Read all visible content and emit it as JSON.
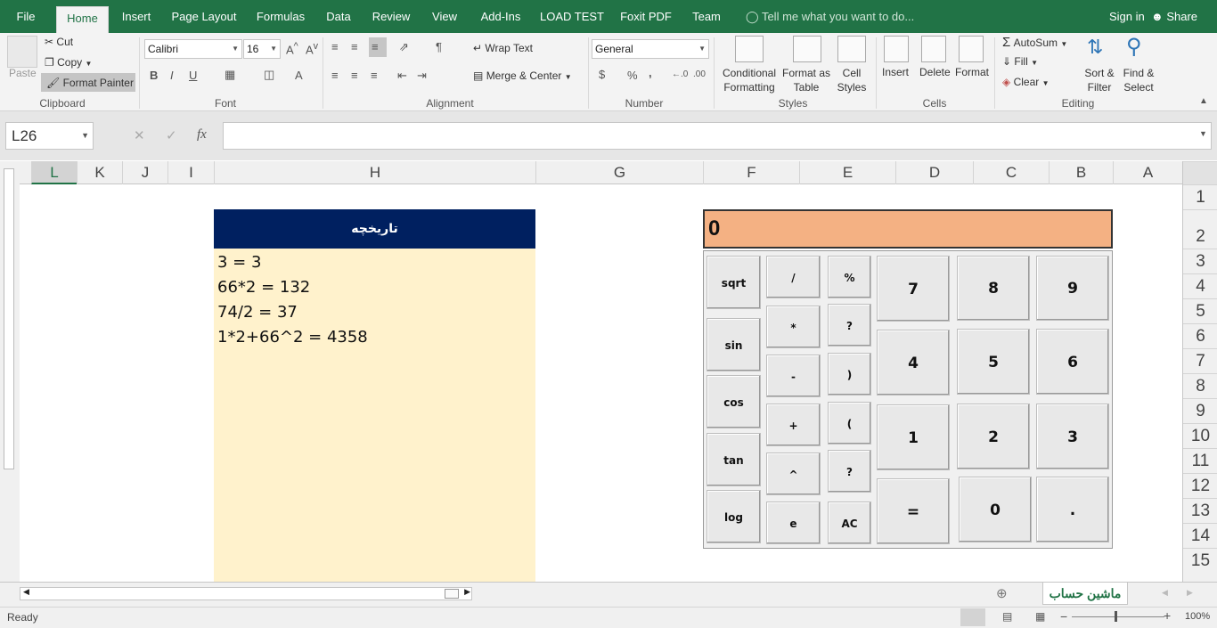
{
  "tabs": {
    "file": "File",
    "home": "Home",
    "insert": "Insert",
    "page_layout": "Page Layout",
    "formulas": "Formulas",
    "data": "Data",
    "review": "Review",
    "view": "View",
    "addins": "Add-Ins",
    "load_test": "LOAD TEST",
    "foxit": "Foxit PDF",
    "team": "Team",
    "tell_me": "Tell me what you want to do...",
    "sign_in": "Sign in",
    "share": "Share"
  },
  "clipboard": {
    "paste": "Paste",
    "cut": "Cut",
    "copy": "Copy",
    "format_painter": "Format Painter",
    "group": "Clipboard"
  },
  "font": {
    "name": "Calibri",
    "size": "16",
    "bold": "B",
    "italic": "I",
    "underline": "U",
    "group": "Font"
  },
  "alignment": {
    "wrap": "Wrap Text",
    "merge": "Merge & Center",
    "group": "Alignment"
  },
  "number": {
    "format": "General",
    "currency": "$",
    "percent": "%",
    "comma": ",",
    "group": "Number"
  },
  "styles": {
    "conditional": "Conditional",
    "conditional2": "Formatting",
    "format_as": "Format as",
    "format_as2": "Table",
    "cell": "Cell",
    "cell2": "Styles",
    "group": "Styles"
  },
  "cells": {
    "insert": "Insert",
    "delete": "Delete",
    "format": "Format",
    "group": "Cells"
  },
  "editing": {
    "autosum": "AutoSum",
    "fill": "Fill",
    "clear": "Clear",
    "sort": "Sort &",
    "sort2": "Filter",
    "find": "Find &",
    "find2": "Select",
    "group": "Editing"
  },
  "formula_bar": {
    "name_box": "L26",
    "fx": "fx",
    "value": ""
  },
  "columns": [
    "L",
    "K",
    "J",
    "I",
    "H",
    "G",
    "F",
    "E",
    "D",
    "C",
    "B",
    "A"
  ],
  "rows": [
    "1",
    "2",
    "3",
    "4",
    "5",
    "6",
    "7",
    "8",
    "9",
    "10",
    "11",
    "12",
    "13",
    "14",
    "15"
  ],
  "history": {
    "title": "تاریخچه",
    "lines": [
      "3 = 3",
      "66*2 = 132",
      "74/2 = 37",
      "1*2+66^2 = 4358"
    ]
  },
  "calculator": {
    "display": "0",
    "fn_buttons": [
      "sqrt",
      "sin",
      "cos",
      "tan",
      "log"
    ],
    "op_buttons": [
      "/",
      "*",
      "-",
      "+",
      "^",
      "e"
    ],
    "misc_buttons": [
      "%",
      "?",
      ")",
      "(",
      "?",
      "AC"
    ],
    "digits": [
      "7",
      "8",
      "9",
      "4",
      "5",
      "6",
      "1",
      "2",
      "3",
      "=",
      "0",
      "."
    ]
  },
  "sheet_tab": "ماشین حساب",
  "status": {
    "ready": "Ready",
    "zoom": "100%"
  },
  "colors": {
    "excel_green": "#217346",
    "history_header": "#002060",
    "history_body": "#fff2cc",
    "display_bg": "#f4b183"
  }
}
